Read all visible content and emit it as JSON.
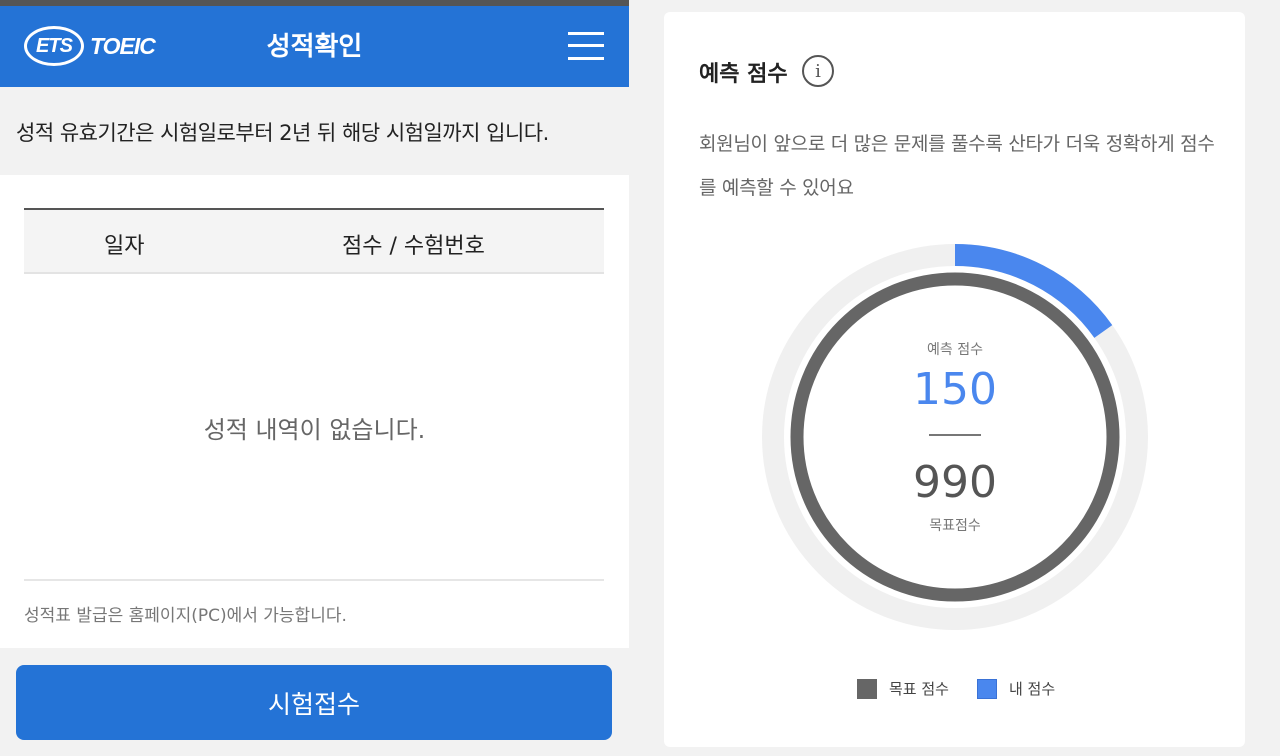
{
  "header": {
    "logo_ets": "ETS",
    "logo_toeic": "TOEIC",
    "title": "성적확인"
  },
  "notice": "성적 유효기간은 시험일로부터 2년 뒤 해당 시험일까지 입니다.",
  "table": {
    "columns": [
      "일자",
      "점수 / 수험번호"
    ],
    "empty_message": "성적 내역이 없습니다."
  },
  "footnote": "성적표 발급은 홈페이지(PC)에서 가능합니다.",
  "apply_button": "시험접수",
  "prediction": {
    "title": "예측 점수",
    "info_icon": "i",
    "description": "회원님이 앞으로 더 많은 문제를 풀수록 산타가 더욱 정확하게 점수를 예측할 수 있어요",
    "pred_label": "예측 점수",
    "pred_score": "150",
    "target_score": "990",
    "target_label": "목표점수",
    "pred_fraction": 0.1515,
    "target_fraction": 1.0,
    "legend": [
      {
        "label": "목표 점수",
        "color": "#666666"
      },
      {
        "label": "내 점수",
        "color": "#4a87ee"
      }
    ]
  },
  "colors": {
    "primary": "#2473d6",
    "pred_arc": "#4a87ee",
    "target_ring": "#666666",
    "track": "#f0f0f0"
  }
}
